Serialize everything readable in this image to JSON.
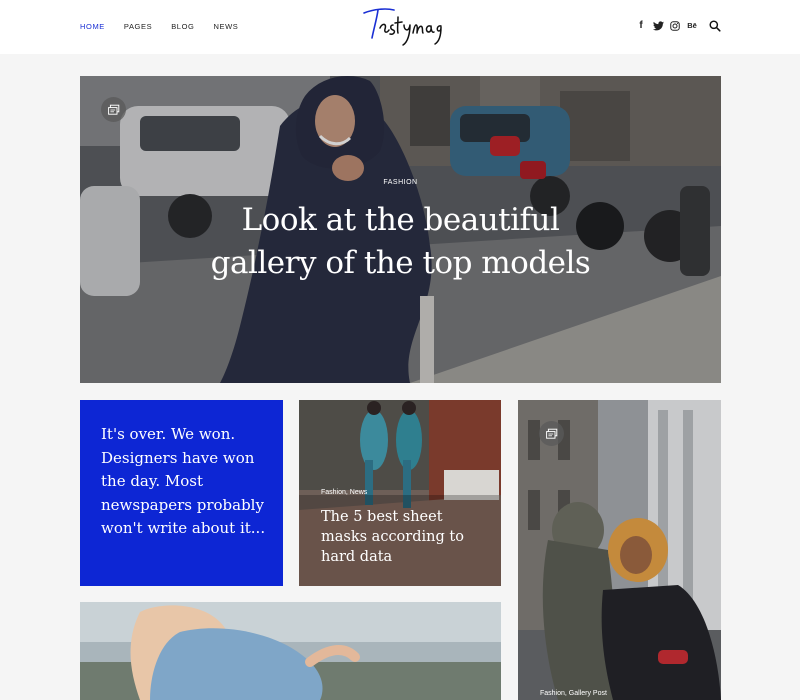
{
  "header": {
    "nav": [
      {
        "label": "HOME",
        "active": true
      },
      {
        "label": "PAGES",
        "active": false
      },
      {
        "label": "BLOG",
        "active": false
      },
      {
        "label": "NEWS",
        "active": false
      }
    ],
    "logo_text": "Tastymag",
    "social": {
      "facebook": "f",
      "behance": "Bē"
    },
    "icons": [
      "facebook-icon",
      "twitter-icon",
      "instagram-icon",
      "behance-icon",
      "search-icon"
    ]
  },
  "hero": {
    "category": "FASHION",
    "title_line1": "Look at the beautiful",
    "title_line2": "gallery of the top models",
    "badge_icon": "gallery-icon"
  },
  "blue_card": {
    "text": "It's over. We won. Designers have won the day. Most newspapers probably won't write about it..."
  },
  "mid_card": {
    "category": "Fashion, News",
    "title": "The 5 best sheet masks according to hard data"
  },
  "right_card": {
    "category": "Fashion, Gallery Post",
    "badge_icon": "gallery-icon"
  },
  "colors": {
    "accent": "#1a2fd4",
    "blue_card_bg": "#0d26d4",
    "header_bg": "#ffffff",
    "page_bg": "#f5f5f5"
  }
}
